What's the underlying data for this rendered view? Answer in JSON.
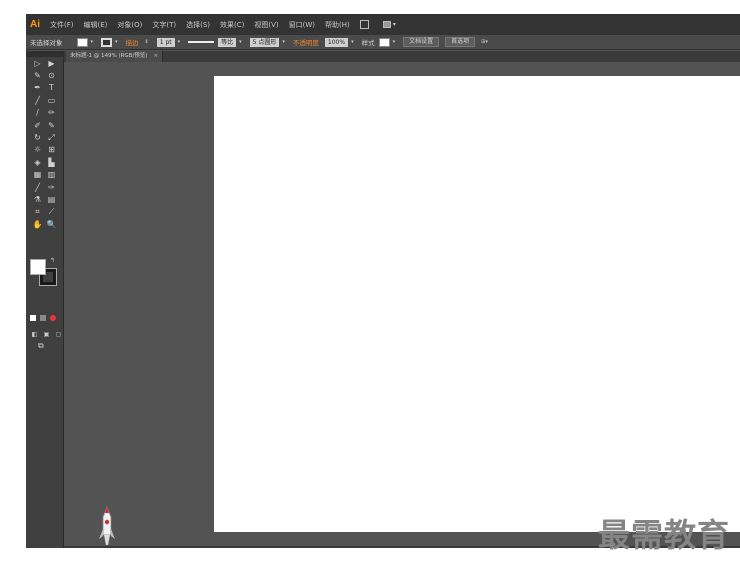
{
  "app": {
    "logo": "Ai"
  },
  "menubar": {
    "items": [
      "文件(F)",
      "编辑(E)",
      "对象(O)",
      "文字(T)",
      "选择(S)",
      "效果(C)",
      "视图(V)",
      "窗口(W)",
      "帮助(H)"
    ]
  },
  "controlbar": {
    "selection_label": "未选择对象",
    "stroke_label": "描边",
    "stroke_width": "1 pt",
    "stroke_profile": "等比",
    "brush": "5 点圆形",
    "opacity_label": "不透明度",
    "opacity_value": "100%",
    "style_label": "样式",
    "doc_setup_button": "文档设置",
    "preferences_button": "首选项"
  },
  "document_tab": {
    "title": "未标题-1 @ 149% (RGB/预览)",
    "close": "×"
  },
  "tools": [
    [
      "▷",
      "▶"
    ],
    [
      "✎",
      "⊙"
    ],
    [
      "✒",
      "T"
    ],
    [
      "╱",
      "▭"
    ],
    [
      "/",
      "✏"
    ],
    [
      "✐",
      "✎"
    ],
    [
      "↻",
      "⤢"
    ],
    [
      "☼",
      "⊞"
    ],
    [
      "◈",
      "▙"
    ],
    [
      "▦",
      "▥"
    ],
    [
      "╱",
      "✑"
    ],
    [
      "⚗",
      "▤"
    ],
    [
      "⌗",
      "⟋"
    ],
    [
      "✋",
      "🔍"
    ]
  ],
  "watermark": "最需教育",
  "colors": {
    "accent": "#f0882a",
    "chrome": "#535353",
    "panel": "#3f3f3f",
    "menubar": "#333333"
  }
}
